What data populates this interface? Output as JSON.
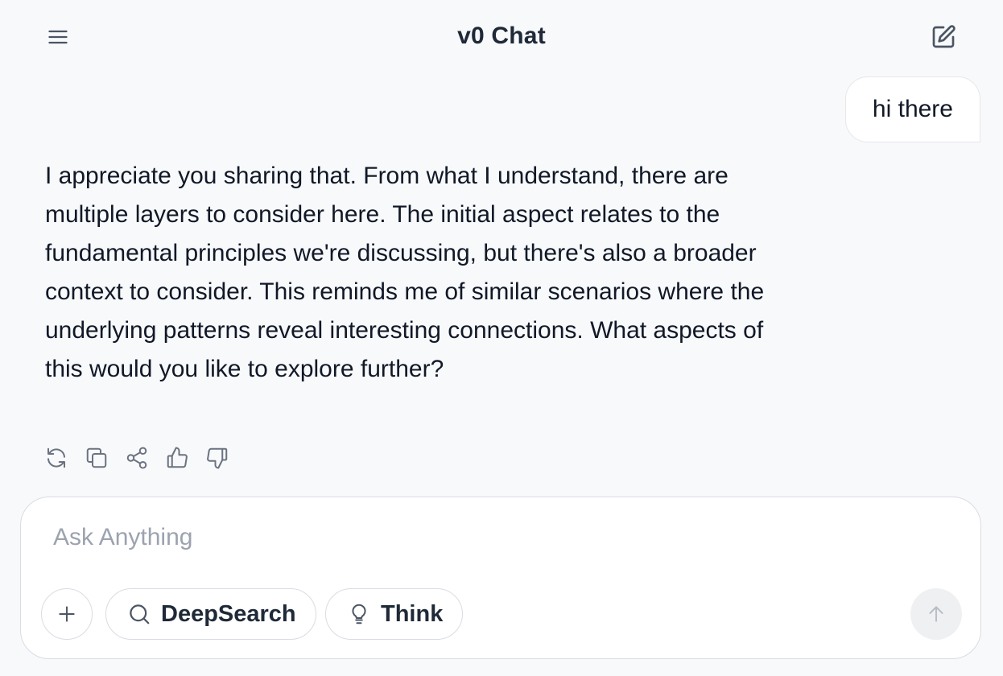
{
  "header": {
    "title": "v0 Chat",
    "menu_icon": "menu-icon",
    "new_chat_icon": "edit-icon"
  },
  "messages": [
    {
      "role": "user",
      "text": "hi there"
    },
    {
      "role": "assistant",
      "text": "I appreciate you sharing that. From what I understand, there are multiple layers to consider here. The initial aspect relates to the fundamental principles we're discussing, but there's also a broader context to consider. This reminds me of similar scenarios where the underlying patterns reveal interesting connections. What aspects of this would you like to explore further?"
    }
  ],
  "message_actions": [
    "refresh-icon",
    "copy-icon",
    "share-icon",
    "thumbs-up-icon",
    "thumbs-down-icon"
  ],
  "composer": {
    "placeholder": "Ask Anything",
    "value": "",
    "attach_icon": "plus-icon",
    "deepsearch_label": "DeepSearch",
    "think_label": "Think",
    "send_icon": "arrow-up-icon"
  },
  "colors": {
    "background": "#f8f9fb",
    "surface": "#ffffff",
    "border": "#d9dce2",
    "text": "#111827",
    "muted": "#9ca3af",
    "icon": "#4b5563"
  }
}
